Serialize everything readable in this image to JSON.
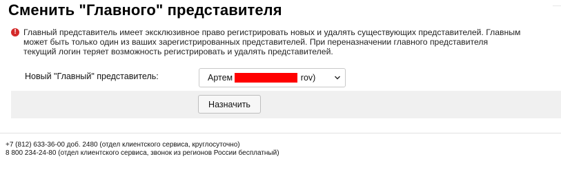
{
  "page": {
    "title": "Сменить \"Главного\" представителя"
  },
  "warning": {
    "icon": "exclamation-icon",
    "color": "#d42a2a",
    "line1": "Главный представитель имеет эксклюзивное право регистрировать новых и удалять существующих представителей. Главным",
    "line2": "может быть только один из ваших зарегистрированных представителей. При переназначении главного представителя",
    "line3": "текущий логин теряет возможность регистрировать и удалять представителей."
  },
  "form": {
    "label": "Новый \"Главный\" представитель:",
    "select": {
      "value_prefix": "Артем (",
      "value_suffix": "rov)",
      "chevron_icon": "chevron-down-icon",
      "redaction_color": "#ff0000"
    },
    "assign_button": "Назначить"
  },
  "footer": {
    "line1": "+7 (812) 633-36-00 доб. 2480 (отдел клиентского сервиса, круглосуточно)",
    "line2": "8 800 234-24-80 (отдел клиентского сервиса, звонок из регионов России бесплатный)"
  }
}
